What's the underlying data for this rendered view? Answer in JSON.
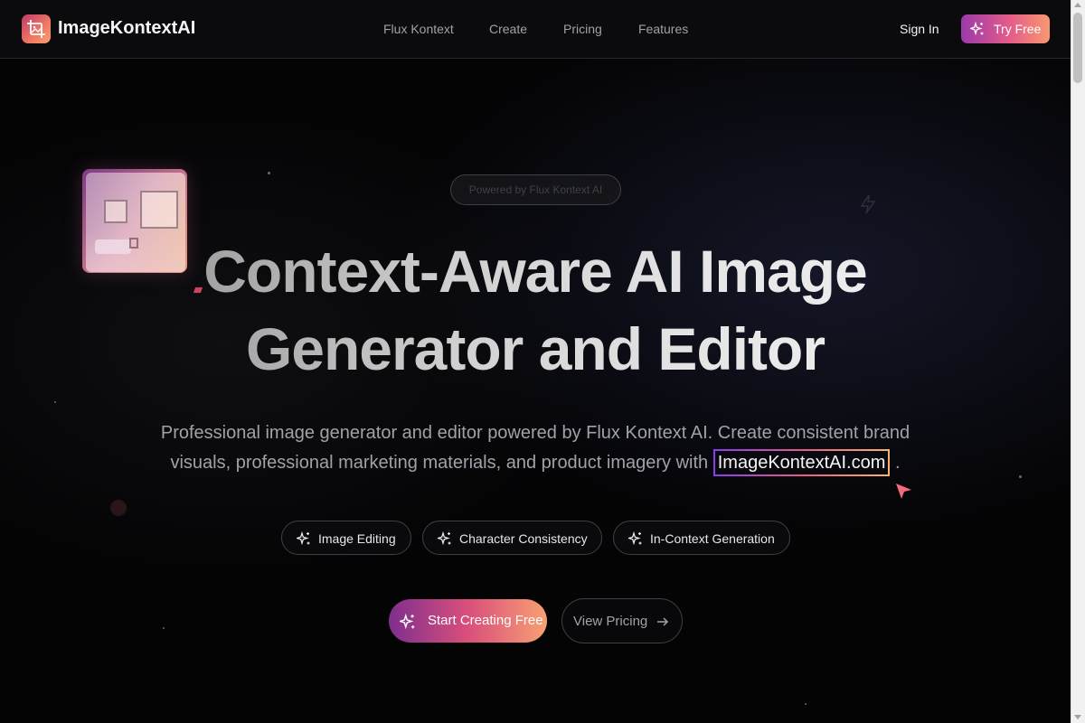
{
  "brand": {
    "name": "ImageKontextAI",
    "logo_icon": "crop-image-icon"
  },
  "nav": {
    "links": [
      "Flux Kontext",
      "Create",
      "Pricing",
      "Features"
    ],
    "sign_in": "Sign In",
    "try_free": "Try Free"
  },
  "hero": {
    "badge": "Powered by Flux Kontext AI",
    "headline_line1": "Context-Aware AI Image",
    "headline_line2": "Generator and Editor",
    "subtitle_line1": "Professional image generator and editor powered by Flux Kontext AI. Create consistent brand",
    "subtitle_line2_before": "visuals, professional marketing materials, and product imagery with",
    "subtitle_highlight": "ImageKontextAI.com",
    "subtitle_line2_after": "."
  },
  "features": [
    "Image Editing",
    "Character Consistency",
    "In-Context Generation"
  ],
  "cta": {
    "primary": "Start Creating Free",
    "secondary": "View Pricing"
  },
  "colors": {
    "accent_start": "#9b3aa8",
    "accent_mid": "#e45c8a",
    "accent_end": "#f8986f",
    "background": "#050507"
  }
}
